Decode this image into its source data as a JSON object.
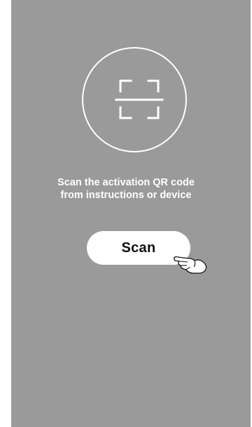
{
  "screen": {
    "instruction_text": "Scan the activation QR code\nfrom instructions or device",
    "scan_button_label": "Scan",
    "icons": {
      "scanner": "qr-scanner-frame-icon",
      "pointer": "pointing-hand-icon"
    },
    "colors": {
      "background": "#9a9a9a",
      "foreground": "#ffffff",
      "button_text": "#111111"
    }
  }
}
